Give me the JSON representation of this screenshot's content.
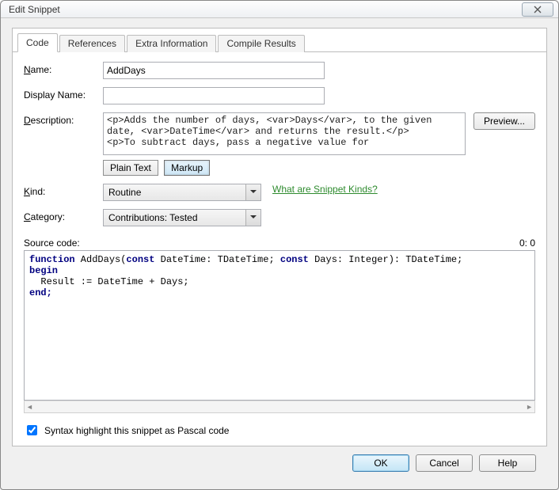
{
  "window": {
    "title": "Edit Snippet"
  },
  "tabs": {
    "t0": "Code",
    "t1": "References",
    "t2": "Extra Information",
    "t3": "Compile Results"
  },
  "labels": {
    "name": "Name:",
    "display_name": "Display Name:",
    "description": "Description:",
    "kind": "Kind:",
    "category": "Category:",
    "source_code": "Source code:",
    "cursor_pos": "0: 0",
    "syntax_check": "Syntax highlight this snippet as Pascal code",
    "snippet_kinds_link": "What are Snippet Kinds?"
  },
  "fields": {
    "name": "AddDays",
    "display_name": "",
    "description": "<p>Adds the number of days, <var>Days</var>, to the given date, <var>DateTime</var> and returns the result.</p>\n<p>To subtract days, pass a negative value for",
    "kind": "Routine",
    "category": "Contributions: Tested",
    "syntax_checked": true,
    "code_line1_a": "function",
    "code_line1_b": " AddDays(",
    "code_line1_c": "const",
    "code_line1_d": " DateTime: TDateTime; ",
    "code_line1_e": "const",
    "code_line1_f": " Days: Integer): TDateTime;",
    "code_line2": "begin",
    "code_line3": "  Result := DateTime + Days;",
    "code_line4": "end;"
  },
  "toggle": {
    "plain_text": "Plain Text",
    "markup": "Markup"
  },
  "buttons": {
    "preview": "Preview...",
    "ok": "OK",
    "cancel": "Cancel",
    "help": "Help"
  }
}
